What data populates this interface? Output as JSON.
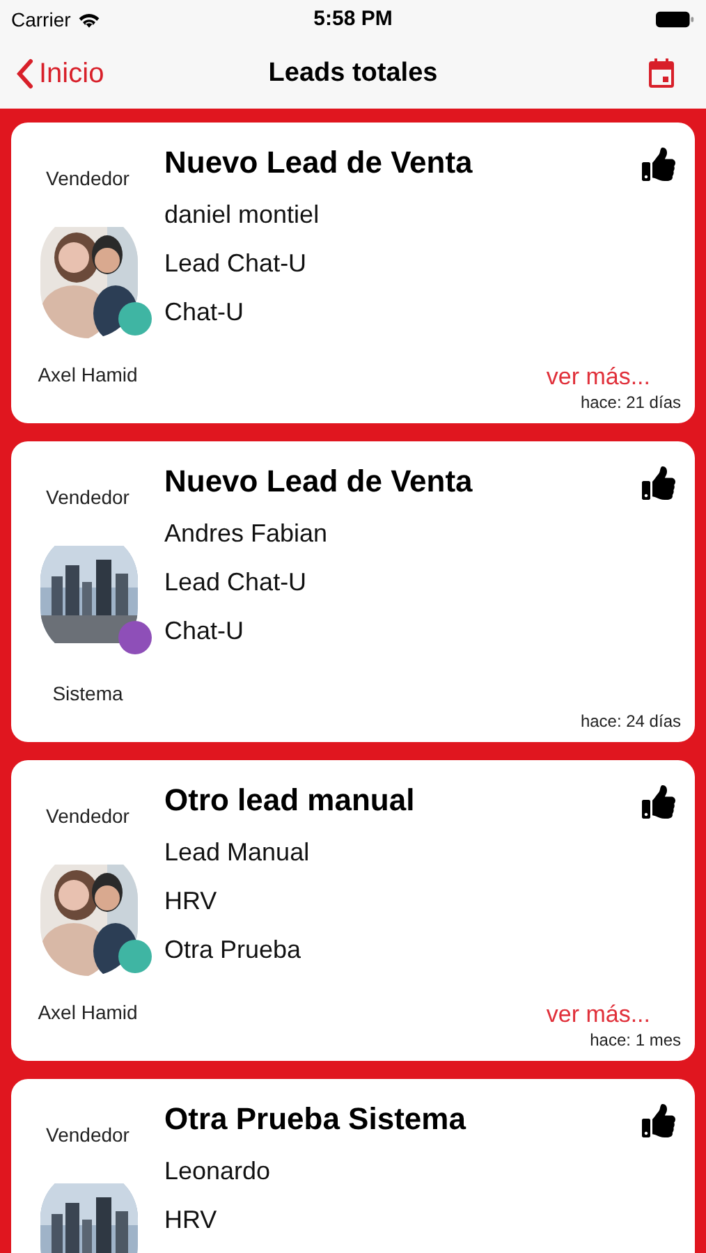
{
  "status_bar": {
    "carrier": "Carrier",
    "time": "5:58 PM"
  },
  "nav": {
    "back": "Inicio",
    "title": "Leads totales"
  },
  "leads": [
    {
      "role": "Vendedor",
      "title": "Nuevo Lead de Venta",
      "lines": [
        "daniel montiel",
        "Lead Chat-U",
        "Chat-U"
      ],
      "seller": "Axel Hamid",
      "color": "#3fb5a3",
      "more": "ver más...",
      "age": "hace: 21 días"
    },
    {
      "role": "Vendedor",
      "title": "Nuevo Lead de Venta",
      "lines": [
        "Andres Fabian",
        "Lead Chat-U",
        "Chat-U"
      ],
      "seller": "Sistema",
      "color": "#8e4fb8",
      "age": "hace: 24 días"
    },
    {
      "role": "Vendedor",
      "title": "Otro lead manual",
      "lines": [
        "Lead Manual",
        "HRV",
        "Otra Prueba"
      ],
      "seller": "Axel Hamid",
      "color": "#3fb5a3",
      "more": "ver más...",
      "age": "hace: 1 mes"
    },
    {
      "role": "Vendedor",
      "title": "Otra Prueba Sistema",
      "lines": [
        "Leonardo",
        "HRV"
      ]
    }
  ]
}
